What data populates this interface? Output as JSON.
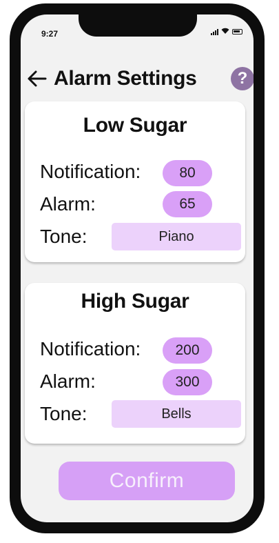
{
  "status_bar": {
    "time": "9:27"
  },
  "header": {
    "title": "Alarm Settings",
    "help_label": "?"
  },
  "low_sugar": {
    "title": "Low Sugar",
    "notification_label": "Notification:",
    "notification_value": "80",
    "alarm_label": "Alarm:",
    "alarm_value": "65",
    "tone_label": "Tone:",
    "tone_value": "Piano"
  },
  "high_sugar": {
    "title": "High Sugar",
    "notification_label": "Notification:",
    "notification_value": "200",
    "alarm_label": "Alarm:",
    "alarm_value": "300",
    "tone_label": "Tone:",
    "tone_value": "Bells"
  },
  "confirm_label": "Confirm",
  "colors": {
    "pill": "#d9a0f7",
    "tone": "#ecd2fb",
    "help": "#8e73a3",
    "confirm": "#d6a0f6"
  },
  "icons": {
    "back": "arrow-left-icon",
    "help": "question-mark-icon"
  }
}
